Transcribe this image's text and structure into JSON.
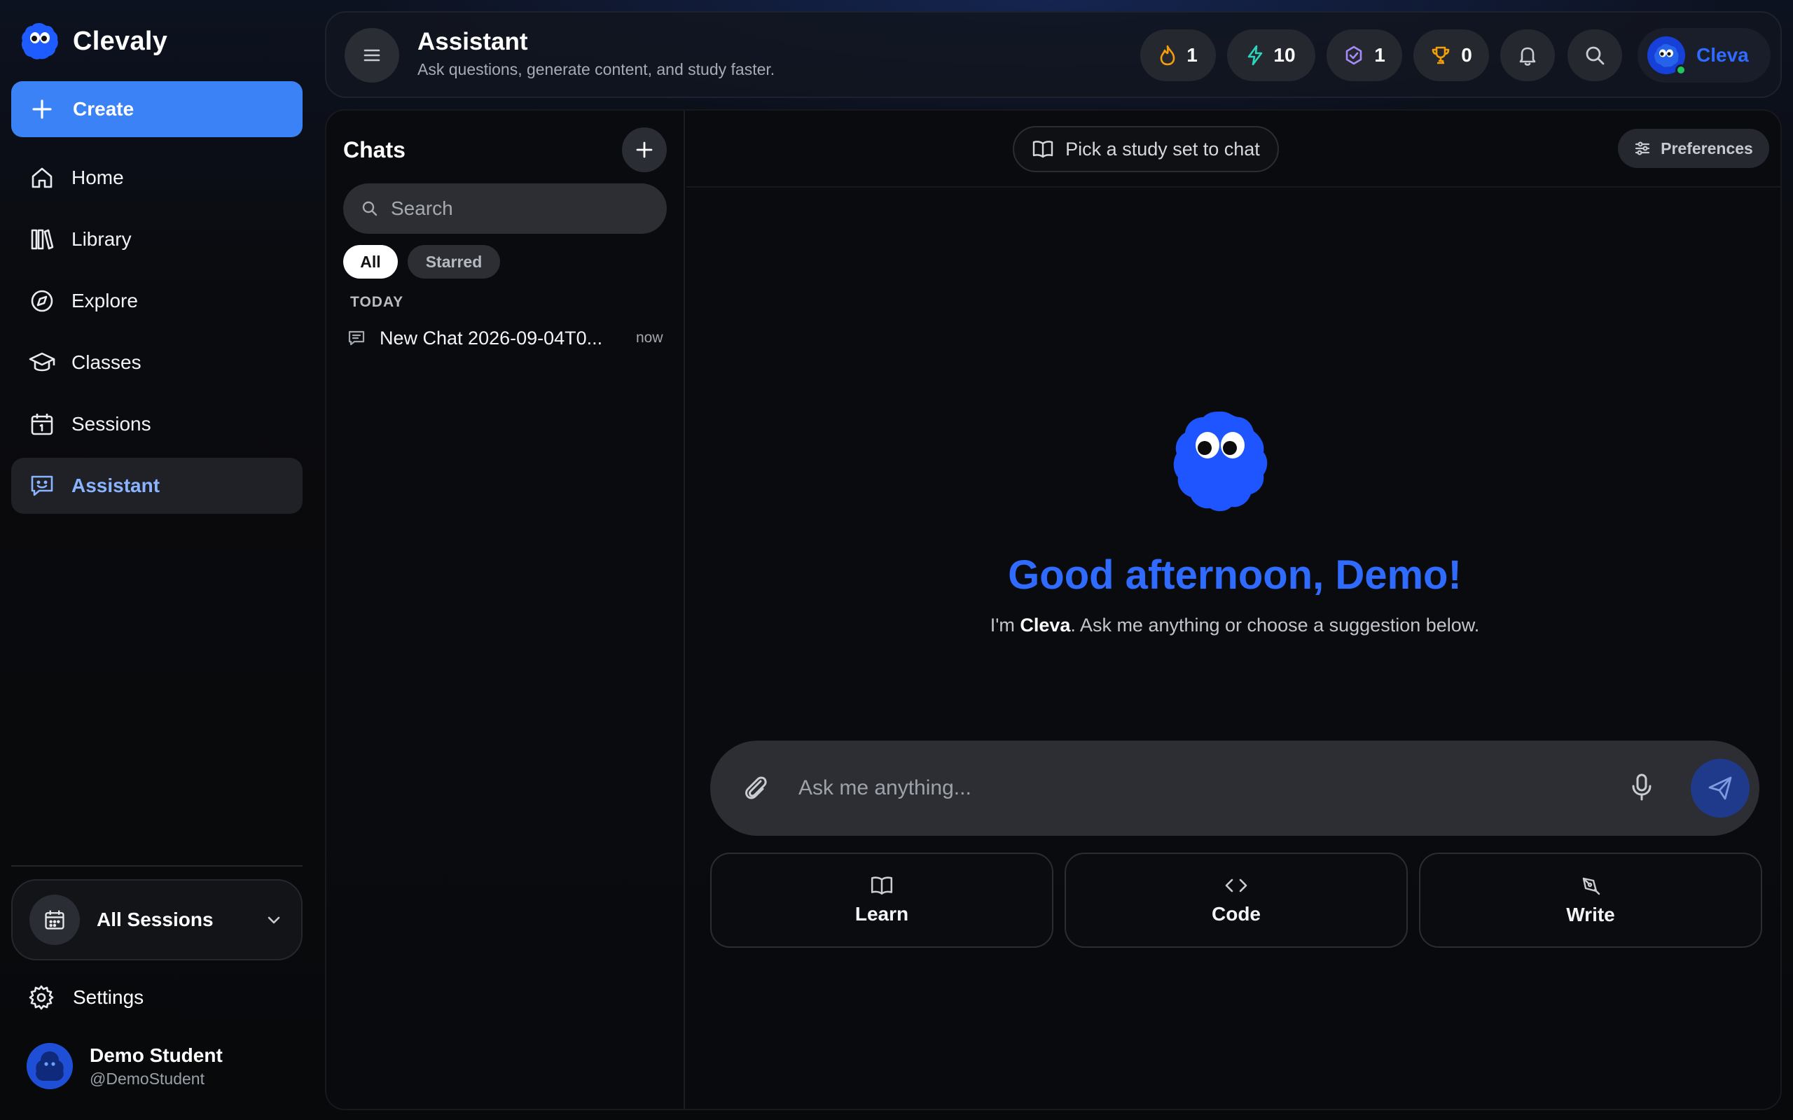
{
  "app": {
    "brand": "Clevaly",
    "accent": "#3b82f6",
    "brand_blue": "#2f6bff"
  },
  "sidebar": {
    "create_label": "Create",
    "items": [
      {
        "label": "Home",
        "icon": "home-icon"
      },
      {
        "label": "Library",
        "icon": "library-icon"
      },
      {
        "label": "Explore",
        "icon": "compass-icon"
      },
      {
        "label": "Classes",
        "icon": "graduation-cap-icon"
      },
      {
        "label": "Sessions",
        "icon": "calendar-icon"
      },
      {
        "label": "Assistant",
        "icon": "chat-bot-icon",
        "active": true
      }
    ],
    "sessions_selector": "All Sessions",
    "settings_label": "Settings",
    "user": {
      "name": "Demo Student",
      "handle": "@DemoStudent"
    }
  },
  "header": {
    "title": "Assistant",
    "subtitle": "Ask questions, generate content, and study faster.",
    "stats": [
      {
        "icon": "flame-icon",
        "value": "1",
        "color": "#f59e0b"
      },
      {
        "icon": "bolt-icon",
        "value": "10",
        "color": "#2dd4bf"
      },
      {
        "icon": "badge-check-icon",
        "value": "1",
        "color": "#a78bfa"
      },
      {
        "icon": "trophy-icon",
        "value": "0",
        "color": "#f59e0b"
      }
    ],
    "profile_label": "Cleva"
  },
  "chats": {
    "title": "Chats",
    "search_placeholder": "Search",
    "filters": [
      "All",
      "Starred"
    ],
    "groups": [
      {
        "label": "TODAY",
        "items": [
          {
            "title": "New Chat 2026-09-04T0...",
            "time": "now"
          }
        ]
      }
    ]
  },
  "chat": {
    "study_set_label": "Pick a study set to chat",
    "preferences_label": "Preferences",
    "greeting": "Good afternoon, Demo!",
    "intro_prefix": "I'm ",
    "intro_name": "Cleva",
    "intro_suffix": ". Ask me anything or choose a suggestion below.",
    "input_placeholder": "Ask me anything...",
    "suggestions": [
      {
        "label": "Learn",
        "icon": "book-icon"
      },
      {
        "label": "Code",
        "icon": "code-icon"
      },
      {
        "label": "Write",
        "icon": "pen-icon"
      }
    ]
  }
}
